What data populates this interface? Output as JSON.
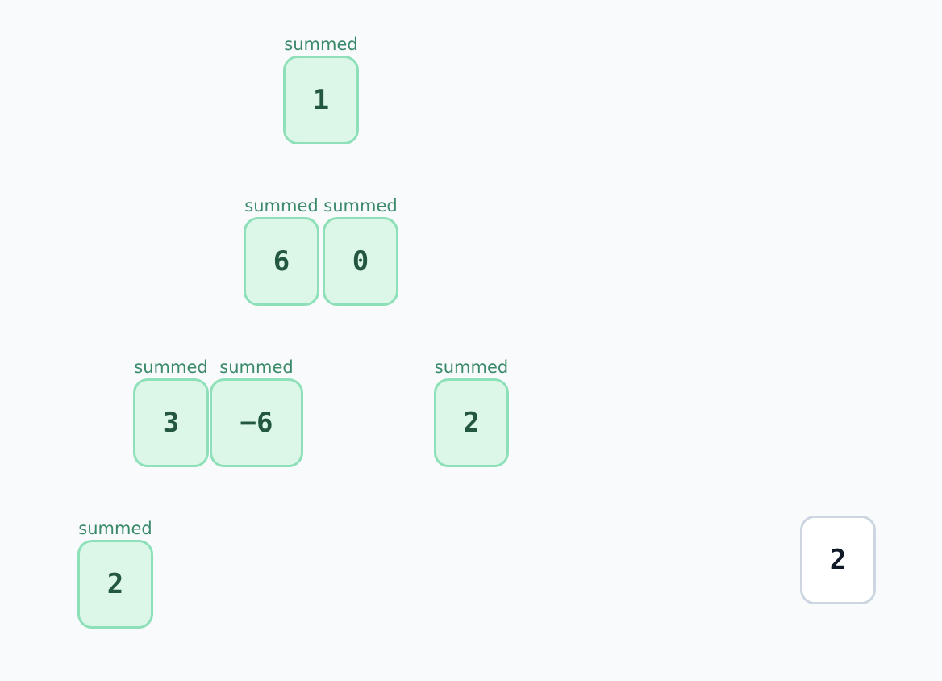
{
  "nodes": [
    {
      "status_label": "summed",
      "value": "1"
    },
    {
      "status_label": "summed",
      "value": "6"
    },
    {
      "status_label": "summed",
      "value": "0"
    },
    {
      "status_label": "summed",
      "value": "3"
    },
    {
      "status_label": "summed",
      "value": "−6"
    },
    {
      "status_label": "summed",
      "value": "2"
    },
    {
      "status_label": "summed",
      "value": "2"
    },
    {
      "status_label": "",
      "value": "2"
    }
  ],
  "colors": {
    "background": "#f8fafc",
    "summed_fill": "#dcf7e8",
    "summed_border": "#8ee0b8",
    "summed_text": "#24573f",
    "label_text": "#3a8a6a",
    "pending_fill": "#ffffff",
    "pending_border": "#cdd5e1",
    "pending_text": "#111827"
  }
}
